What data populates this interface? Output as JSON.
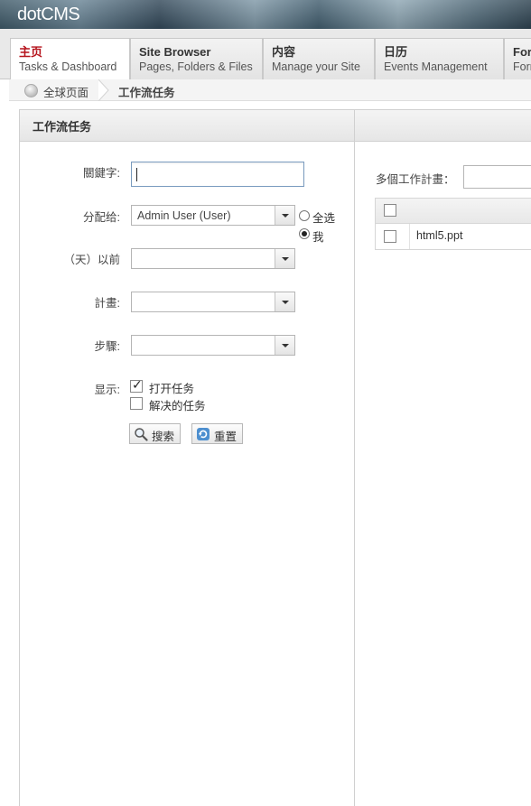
{
  "app": {
    "logo": "dotCMS"
  },
  "tabs": [
    {
      "title": "主页",
      "subtitle": "Tasks & Dashboard",
      "active": true
    },
    {
      "title": "Site Browser",
      "subtitle": "Pages, Folders & Files",
      "active": false
    },
    {
      "title": "内容",
      "subtitle": "Manage your Site",
      "active": false
    },
    {
      "title": "日历",
      "subtitle": "Events Management",
      "active": false
    },
    {
      "title": "For",
      "subtitle": "Form",
      "active": false
    }
  ],
  "breadcrumb": {
    "home": "全球页面",
    "current": "工作流任务"
  },
  "filter_panel": {
    "title": "工作流任务",
    "keyword_label": "關鍵字:",
    "keyword_value": "",
    "assigned_label": "分配给:",
    "assigned_value": "Admin User (User)",
    "radio_all": "全选",
    "radio_me": "我",
    "radio_selected": "me",
    "days_label": "（天）以前",
    "days_value": "",
    "scheme_label": "計畫:",
    "scheme_value": "",
    "step_label": "步驟:",
    "step_value": "",
    "show_label": "显示:",
    "show_open_label": "打开任务",
    "show_open_checked": true,
    "show_resolved_label": "解决的任务",
    "show_resolved_checked": false,
    "search_button": "搜索",
    "reset_button": "重置"
  },
  "results_panel": {
    "multi_scheme_label": "多個工作計畫：",
    "multi_scheme_value": "",
    "rows": [
      {
        "name": "html5.ppt",
        "checked": false
      }
    ]
  }
}
